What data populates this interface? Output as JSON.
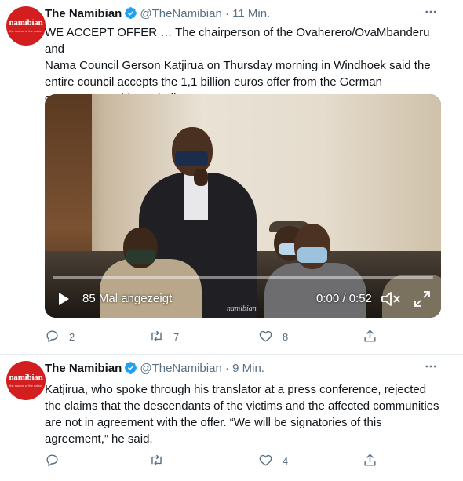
{
  "colors": {
    "accent": "#1da1f2",
    "text": "#0f1419",
    "secondary": "#5b7083",
    "avatar_bg": "#d21e1e"
  },
  "tweets": [
    {
      "avatar_text": "namibian",
      "avatar_sub": "the source of the nation",
      "name": "The Namibian",
      "handle": "@TheNamibian",
      "time": "· 11 Min.",
      "more_icon": "more-horizontal-icon",
      "text": "WE ACCEPT OFFER … The chairperson of the Ovaherero/OvaMbanderu and\nNama Council Gerson Katjirua on Thursday morning in Windhoek said the\nentire council accepts the 1,1 billion euros offer from the German\ngovernment. Video: Shelleygan Petersen",
      "video": {
        "views": "85 Mal angezeigt",
        "time": "0:00 / 0:52",
        "progress": 0,
        "watermark": "namibian"
      },
      "actions": {
        "replies": "2",
        "retweets": "7",
        "likes": "8"
      }
    },
    {
      "avatar_text": "namibian",
      "avatar_sub": "the source of the nation",
      "name": "The Namibian",
      "handle": "@TheNamibian",
      "time": "· 9 Min.",
      "more_icon": "more-horizontal-icon",
      "text": "Katjirua, who spoke through his translator at a press conference, rejected\nthe claims that the descendants of the victims and the affected communities\nare not in agreement with the offer.  “We will be signatories of this\nagreement,” he said.",
      "actions": {
        "replies": "",
        "retweets": "",
        "likes": "4"
      }
    }
  ]
}
